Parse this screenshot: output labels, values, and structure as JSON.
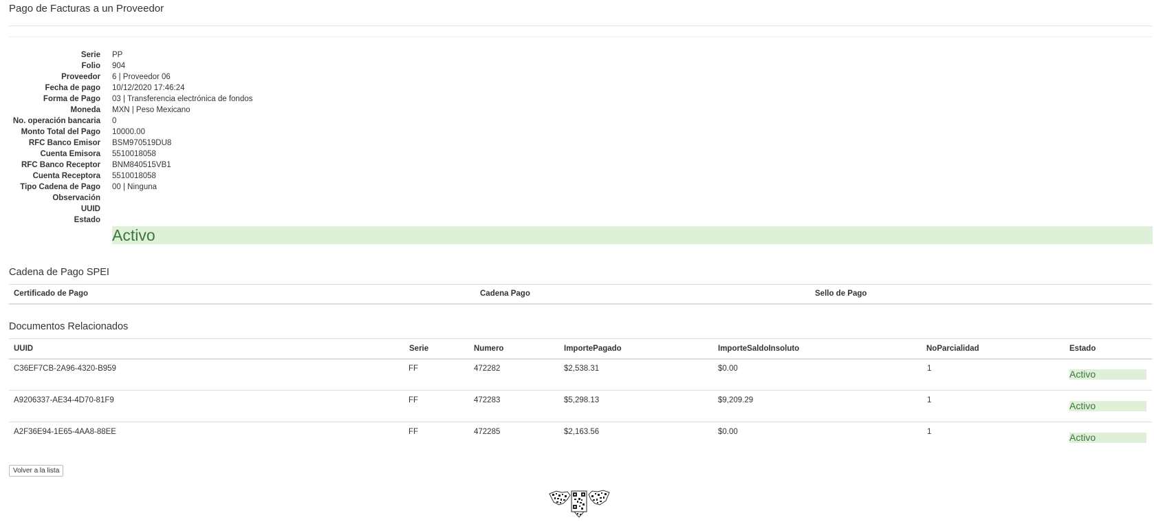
{
  "page": {
    "title": "Pago de Facturas a un Proveedor"
  },
  "details": [
    {
      "label": "Serie",
      "value": "PP"
    },
    {
      "label": "Folio",
      "value": "904"
    },
    {
      "label": "Proveedor",
      "value": "6 | Proveedor 06"
    },
    {
      "label": "Fecha de pago",
      "value": "10/12/2020 17:46:24"
    },
    {
      "label": "Forma de Pago",
      "value": "03 | Transferencia electrónica de fondos"
    },
    {
      "label": "Moneda",
      "value": "MXN | Peso Mexicano"
    },
    {
      "label": "No. operación bancaria",
      "value": "0"
    },
    {
      "label": "Monto Total del Pago",
      "value": "10000.00"
    },
    {
      "label": "RFC Banco Emisor",
      "value": "BSM970519DU8"
    },
    {
      "label": "Cuenta Emisora",
      "value": "5510018058"
    },
    {
      "label": "RFC Banco Receptor",
      "value": "BNM840515VB1"
    },
    {
      "label": "Cuenta Receptora",
      "value": "5510018058"
    },
    {
      "label": "Tipo Cadena de Pago",
      "value": "00 | Ninguna"
    },
    {
      "label": "Observación",
      "value": ""
    },
    {
      "label": "UUID",
      "value": ""
    },
    {
      "label": "Estado",
      "value": ""
    }
  ],
  "estado_badge": "Activo",
  "cadena": {
    "title": "Cadena de Pago SPEI",
    "headers": [
      "Certificado de Pago",
      "Cadena Pago",
      "Sello de Pago"
    ]
  },
  "documentos": {
    "title": "Documentos Relacionados",
    "headers": [
      "UUID",
      "Serie",
      "Numero",
      "ImportePagado",
      "ImporteSaldoInsoluto",
      "NoParcialidad",
      "Estado"
    ],
    "rows": [
      {
        "uuid": "C36EF7CB-2A96-4320-B959",
        "serie": "FF",
        "numero": "472282",
        "importe_pagado": "$2,538.31",
        "saldo_insoluto": "$0.00",
        "parcialidad": "1",
        "estado": "Activo"
      },
      {
        "uuid": "A9206337-AE34-4D70-81F9",
        "serie": "FF",
        "numero": "472283",
        "importe_pagado": "$5,298.13",
        "saldo_insoluto": "$9,209.29",
        "parcialidad": "1",
        "estado": "Activo"
      },
      {
        "uuid": "A2F36E94-1E65-4AA8-88EE",
        "serie": "FF",
        "numero": "472285",
        "importe_pagado": "$2,163.56",
        "saldo_insoluto": "$0.00",
        "parcialidad": "1",
        "estado": "Activo"
      }
    ]
  },
  "back_button": "Volver a la lista",
  "colors": {
    "status_bg": "#dff0d8",
    "status_text": "#3c763d"
  },
  "seal_icon": "qr-seal-icon"
}
